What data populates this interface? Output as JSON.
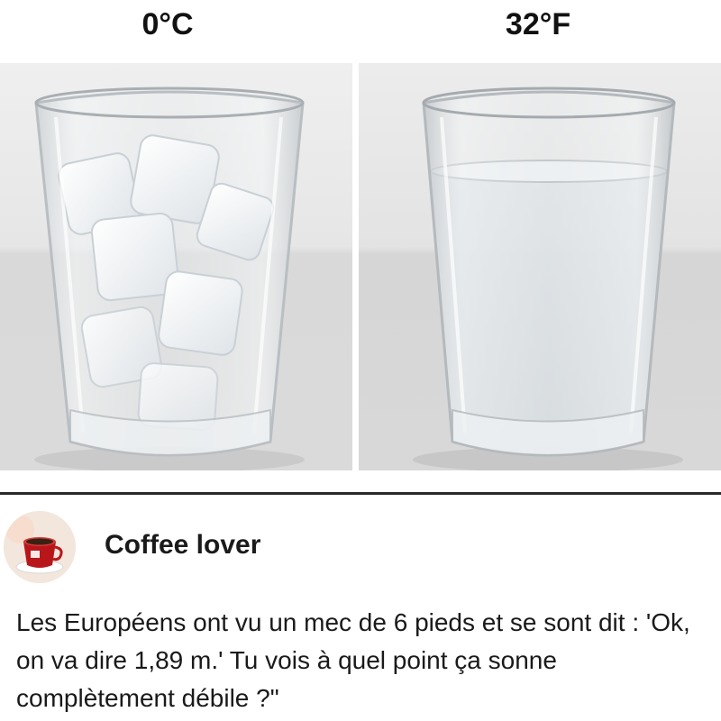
{
  "panels": [
    {
      "label": "0°C",
      "image": "glass-of-ice-cubes"
    },
    {
      "label": "32°F",
      "image": "glass-of-water"
    }
  ],
  "post": {
    "author": "Coffee lover",
    "avatar": "coffee-cup-icon",
    "text": "Les Européens ont vu un mec de 6 pieds et se sont dit : 'Ok, on va dire 1,89 m.' Tu vois à quel point ça sonne complètement débile ?\""
  },
  "colors": {
    "background": "#ffffff",
    "photo_wall": "#e9e9e9",
    "photo_table": "#d7d7d7",
    "divider": "#2a2a2a",
    "text": "#1a1a1a",
    "cup_red": "#b8161b"
  }
}
